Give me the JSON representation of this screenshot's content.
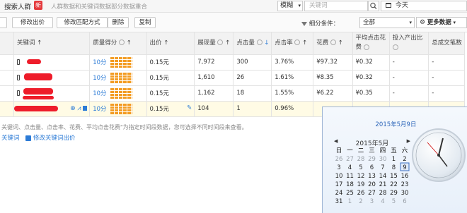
{
  "topbar": {
    "brand": "搜索人群",
    "new_badge": "新",
    "note": "人群数据和关键词数据部分数据重合",
    "mode": "模糊",
    "keyword_placeholder": "关键词",
    "date": "今天"
  },
  "toolbar": {
    "buttons": [
      "修改出价",
      "修改匹配方式",
      "删除",
      "复制"
    ],
    "filter_label": "细分条件：",
    "filter_value": "全部",
    "more": "更多数据"
  },
  "table": {
    "headers": [
      "关键词",
      "质量得分",
      "出价",
      "展现量",
      "点击量",
      "点击率",
      "花费",
      "平均点击花费",
      "投入产出比",
      "总成交笔数"
    ],
    "rows": [
      {
        "quality": "10分",
        "bid": "0.15元",
        "impressions": "7,972",
        "clicks": "300",
        "ctr": "3.76%",
        "cost": "¥97.32",
        "cpc": "¥0.32",
        "roi": "-",
        "orders": "-"
      },
      {
        "quality": "10分",
        "bid": "0.15元",
        "impressions": "1,610",
        "clicks": "26",
        "ctr": "1.61%",
        "cost": "¥8.35",
        "cpc": "¥0.32",
        "roi": "-",
        "orders": "-"
      },
      {
        "quality": "10分",
        "bid": "0.15元",
        "impressions": "1,162",
        "clicks": "18",
        "ctr": "1.55%",
        "cost": "¥6.22",
        "cpc": "¥0.35",
        "roi": "-",
        "orders": "-"
      },
      {
        "quality": "10分",
        "bid": "0.15元",
        "impressions": "104",
        "clicks": "1",
        "ctr": "0.96%",
        "cost": "",
        "cpc": "",
        "roi": "",
        "orders": ""
      }
    ]
  },
  "footnote": "关键词、点击量、点击率、花费、平均点击花费\"为指定时间段数据，您可选择不同时间段来查看。",
  "footer_links": [
    "关键词",
    "修改关键词出价"
  ],
  "calendar": {
    "header": "2015年5月9日",
    "month_title": "2015年5月",
    "weekdays": [
      "日",
      "一",
      "二",
      "三",
      "四",
      "五",
      "六"
    ],
    "weeks": [
      [
        "26",
        "27",
        "28",
        "29",
        "30",
        "1",
        "2"
      ],
      [
        "3",
        "4",
        "5",
        "6",
        "7",
        "8",
        "9"
      ],
      [
        "10",
        "11",
        "12",
        "13",
        "14",
        "15",
        "16"
      ],
      [
        "17",
        "18",
        "19",
        "20",
        "21",
        "22",
        "23"
      ],
      [
        "24",
        "25",
        "26",
        "27",
        "28",
        "29",
        "30"
      ],
      [
        "31",
        "1",
        "2",
        "3",
        "4",
        "5",
        "6"
      ]
    ],
    "selected_day": "9"
  }
}
